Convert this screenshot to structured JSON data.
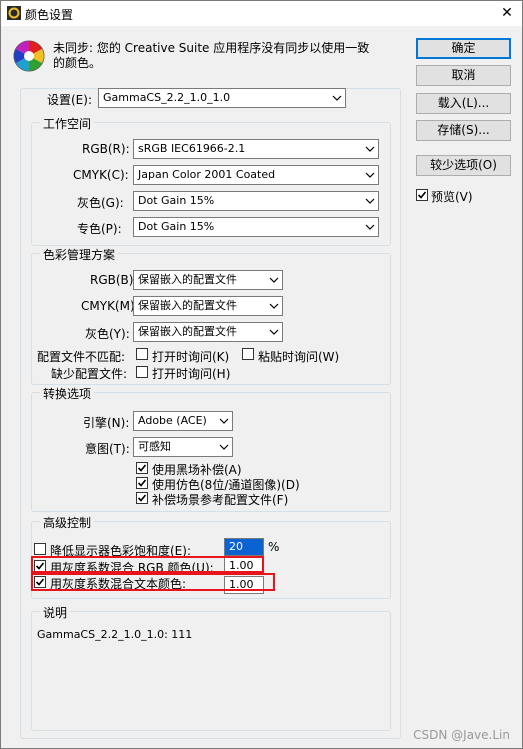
{
  "window": {
    "title": "颜色设置",
    "close_icon": "close-icon"
  },
  "header": {
    "icon": "color-wheel-icon",
    "message": "未同步: 您的 Creative Suite 应用程序没有同步以使用一致",
    "message2": "的颜色。"
  },
  "buttons": {
    "ok": "确定",
    "cancel": "取消",
    "load": "载入(L)...",
    "save": "存储(S)...",
    "fewer_options": "较少选项(O)",
    "preview": "预览(V)"
  },
  "settings": {
    "label": "设置(E):",
    "value": "GammaCS_2.2_1.0_1.0"
  },
  "working_spaces": {
    "title": "工作空间",
    "rgb": {
      "label": "RGB(R):",
      "value": "sRGB IEC61966-2.1"
    },
    "cmyk": {
      "label": "CMYK(C):",
      "value": "Japan Color 2001 Coated"
    },
    "gray": {
      "label": "灰色(G):",
      "value": "Dot Gain 15%"
    },
    "spot": {
      "label": "专色(P):",
      "value": "Dot Gain 15%"
    }
  },
  "policies": {
    "title": "色彩管理方案",
    "rgb": {
      "label": "RGB(B):",
      "value": "保留嵌入的配置文件"
    },
    "cmyk": {
      "label": "CMYK(M):",
      "value": "保留嵌入的配置文件"
    },
    "gray": {
      "label": "灰色(Y):",
      "value": "保留嵌入的配置文件"
    },
    "mismatch_label": "配置文件不匹配:",
    "ask_open": "打开时询问(K)",
    "ask_paste": "粘贴时询问(W)",
    "missing_label": "缺少配置文件:",
    "missing_ask_open": "打开时询问(H)"
  },
  "conversion": {
    "title": "转换选项",
    "engine": {
      "label": "引擎(N):",
      "value": "Adobe (ACE)"
    },
    "intent": {
      "label": "意图(T):",
      "value": "可感知"
    },
    "bpc": "使用黑场补偿(A)",
    "dither": "使用仿色(8位/通道图像)(D)",
    "compensate": "补偿场景参考配置文件(F)"
  },
  "advanced": {
    "title": "高级控制",
    "desaturate": {
      "label": "降低显示器色彩饱和度(E):",
      "value": "20",
      "unit": "%"
    },
    "blend_rgb": {
      "label": "用灰度系数混合 RGB 颜色(U):",
      "value": "1.00"
    },
    "blend_text": {
      "label": "用灰度系数混合文本颜色:",
      "value": "1.00"
    }
  },
  "description": {
    "title": "说明",
    "text": "GammaCS_2.2_1.0_1.0:  111"
  },
  "watermark": "CSDN @Jave.Lin"
}
